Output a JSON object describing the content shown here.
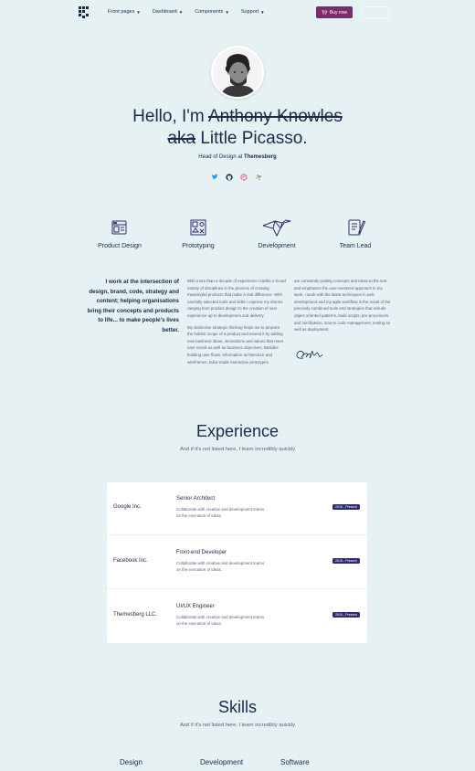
{
  "nav": {
    "items": [
      {
        "label": "Front pages"
      },
      {
        "label": "Dashboard"
      },
      {
        "label": "Components"
      },
      {
        "label": "Support"
      }
    ],
    "buy_label": "Buy now",
    "ghost_label": ""
  },
  "hero": {
    "greeting": "Hello, I'm",
    "struck_name": "Anthony Knowles",
    "struck_aka": "aka",
    "nickname": "Little Picasso.",
    "subtitle_prefix": "Head of Design at",
    "company": "Themesberg",
    "socials": [
      "twitter-icon",
      "github-icon",
      "dribbble-icon",
      "slack-icon"
    ]
  },
  "services": [
    {
      "label": "Product Design",
      "icon": "design-layout-icon"
    },
    {
      "label": "Prototyping",
      "icon": "prototype-icon"
    },
    {
      "label": "Development",
      "icon": "origami-bird-icon"
    },
    {
      "label": "Team Lead",
      "icon": "notebook-pen-icon"
    }
  ],
  "about": {
    "lead": "I work at the intersection of design, brand, code, strategy and content; helping organisations bring their concepts and products to life... to make people's lives better.",
    "col1_p1": "With more than a decade of experience I tackle a broad variety of disciplines in the process of creating meaningful products that make a real difference. With carefully selected tools and skills I express my visions ranging from product design to the creation of user experience up to development and delivery.",
    "col1_p2": "My distinctive strategic thinking helps me to pinpoint the holistic scope of a product and extend it by adding new business ideas, innovations and values that meet user needs as well as business objectives. Besides building user flows, information architecture and wireframes, tailor-made interactive prototypes",
    "col2_p1": "are constantly putting concepts and ideas to the test and emphasize the user-centered approach in my work. I work with the latest techniques in web development and my agile workflow is the result of the precisely combined tools and strategies that include object oriented patterns, build scripts, pre-processors and minification, source code management, testing as well as deployment."
  },
  "experience": {
    "title": "Experience",
    "subtitle": "And if it's not listed here, I learn incredibly quickly",
    "rows": [
      {
        "company": "Google Inc.",
        "role": "Senior Architect",
        "desc": "Collaborate with creative and development teams on the execution of ideas.",
        "badge": "2015 - Present"
      },
      {
        "company": "Facebook Inc.",
        "role": "Front-end Developer",
        "desc": "Collaborate with creative and development teams on the execution of ideas.",
        "badge": "2015 - Present"
      },
      {
        "company": "Themesberg LLC.",
        "role": "UI/UX Engineer",
        "desc": "Collaborate with creative and development teams on the execution of ideas.",
        "badge": "2015 - Present"
      }
    ]
  },
  "skills": {
    "title": "Skills",
    "subtitle": "And if it's not listed here, I learn incredibly quickly",
    "columns": [
      "Design",
      "Development",
      "Software"
    ]
  },
  "colors": {
    "background": "#e6f1f4",
    "text": "#1c2a4a",
    "accent": "#7a2c6e",
    "badge": "#2e2c6e"
  }
}
